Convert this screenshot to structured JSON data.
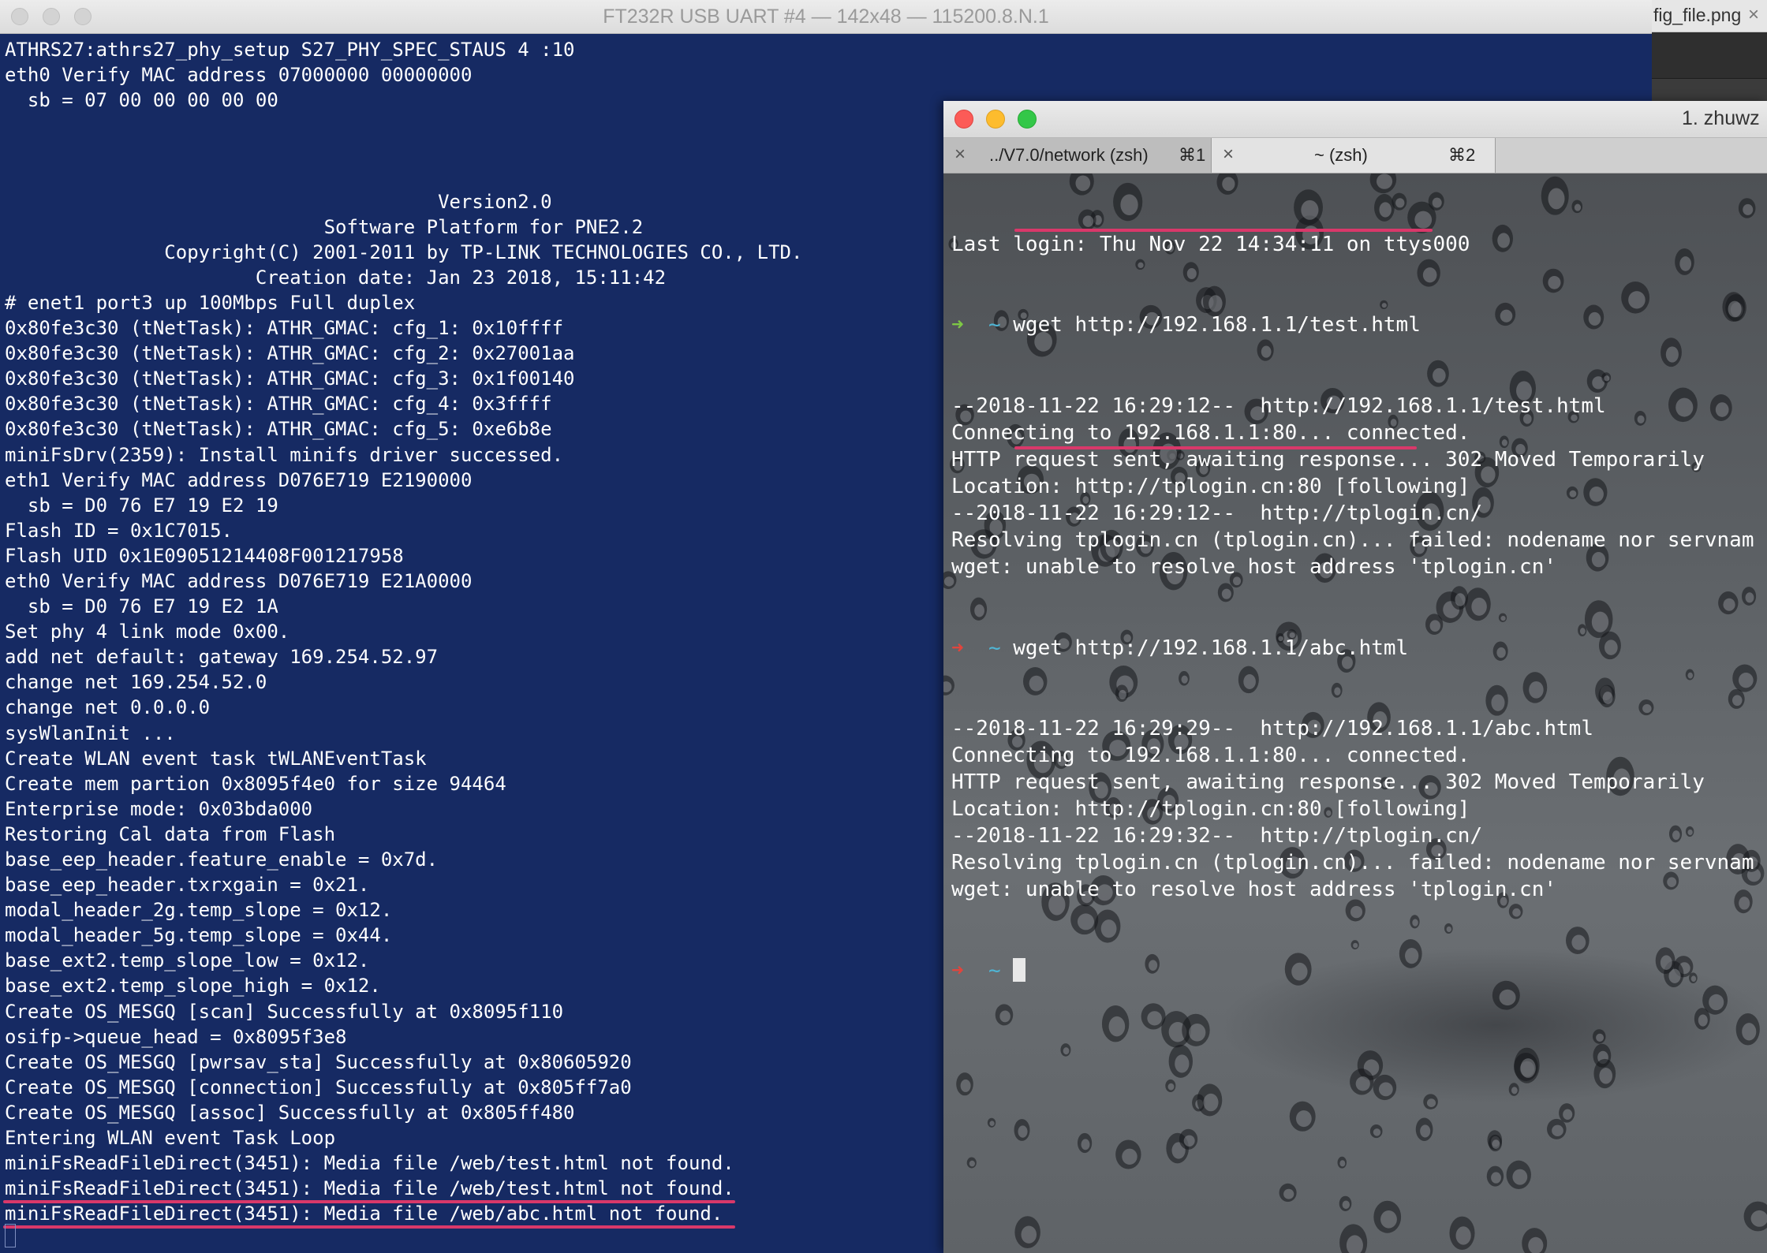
{
  "background_window": {
    "tab_name": "fig_file.png",
    "tab_close": "×"
  },
  "serial_window": {
    "title": "FT232R USB UART #4 — 142x48 — 115200.8.N.1",
    "lines": [
      "ATHRS27:athrs27_phy_setup S27_PHY_SPEC_STAUS 4 :10",
      "eth0 Verify MAC address 07000000 00000000",
      "  sb = 07 00 00 00 00 00",
      "",
      "",
      "",
      "                                      Version2.0",
      "                            Software Platform for PNE2.2",
      "              Copyright(C) 2001-2011 by TP-LINK TECHNOLOGIES CO., LTD.",
      "                      Creation date: Jan 23 2018, 15:11:42",
      "# enet1 port3 up 100Mbps Full duplex",
      "0x80fe3c30 (tNetTask): ATHR_GMAC: cfg_1: 0x10ffff",
      "0x80fe3c30 (tNetTask): ATHR_GMAC: cfg_2: 0x27001aa",
      "0x80fe3c30 (tNetTask): ATHR_GMAC: cfg_3: 0x1f00140",
      "0x80fe3c30 (tNetTask): ATHR_GMAC: cfg_4: 0x3ffff",
      "0x80fe3c30 (tNetTask): ATHR_GMAC: cfg_5: 0xe6b8e",
      "miniFsDrv(2359): Install minifs driver successed.",
      "eth1 Verify MAC address D076E719 E2190000",
      "  sb = D0 76 E7 19 E2 19",
      "Flash ID = 0x1C7015.",
      "Flash UID 0x1E09051214408F001217958",
      "eth0 Verify MAC address D076E719 E21A0000",
      "  sb = D0 76 E7 19 E2 1A",
      "Set phy 4 link mode 0x00.",
      "add net default: gateway 169.254.52.97",
      "change net 169.254.52.0",
      "change net 0.0.0.0",
      "sysWlanInit ...",
      "Create WLAN event task tWLANEventTask",
      "Create mem partion 0x8095f4e0 for size 94464",
      "Enterprise mode: 0x03bda000",
      "Restoring Cal data from Flash",
      "base_eep_header.feature_enable = 0x7d.",
      "base_eep_header.txrxgain = 0x21.",
      "modal_header_2g.temp_slope = 0x12.",
      "modal_header_5g.temp_slope = 0x44.",
      "base_ext2.temp_slope_low = 0x12.",
      "base_ext2.temp_slope_high = 0x12.",
      "Create OS_MESGQ [scan] Successfully at 0x8095f110",
      "osifp->queue_head = 0x8095f3e8",
      "Create OS_MESGQ [pwrsav_sta] Successfully at 0x80605920",
      "Create OS_MESGQ [connection] Successfully at 0x805ff7a0",
      "Create OS_MESGQ [assoc] Successfully at 0x805ff480",
      "Entering WLAN event Task Loop",
      "miniFsReadFileDirect(3451): Media file /web/test.html not found.",
      "miniFsReadFileDirect(3451): Media file /web/test.html not found.",
      "miniFsReadFileDirect(3451): Media file /web/abc.html not found."
    ]
  },
  "iterm_window": {
    "title": "1. zhuwz",
    "tabs": [
      {
        "close": "×",
        "label": "../V7.0/network (zsh)",
        "shortcut": "⌘1"
      },
      {
        "close": "×",
        "label": "~ (zsh)",
        "shortcut": "⌘2"
      }
    ],
    "prompt_arrow": "➜",
    "prompt_tilde": "~",
    "last_login": "Last login: Thu Nov 22 14:34:11 on ttys000",
    "cmd1": "wget http://192.168.1.1/test.html",
    "out1": [
      "--2018-11-22 16:29:12--  http://192.168.1.1/test.html",
      "Connecting to 192.168.1.1:80... connected.",
      "HTTP request sent, awaiting response... 302 Moved Temporarily",
      "Location: http://tplogin.cn:80 [following]",
      "--2018-11-22 16:29:12--  http://tplogin.cn/",
      "Resolving tplogin.cn (tplogin.cn)... failed: nodename nor servnam",
      "wget: unable to resolve host address 'tplogin.cn'"
    ],
    "cmd2": "wget http://192.168.1.1/abc.html",
    "out2": [
      "--2018-11-22 16:29:29--  http://192.168.1.1/abc.html",
      "Connecting to 192.168.1.1:80... connected.",
      "HTTP request sent, awaiting response... 302 Moved Temporarily",
      "Location: http://tplogin.cn:80 [following]",
      "--2018-11-22 16:29:32--  http://tplogin.cn/",
      "Resolving tplogin.cn (tplogin.cn)... failed: nodename nor servnam",
      "wget: unable to resolve host address 'tplogin.cn'"
    ]
  },
  "colors": {
    "serial_bg": "#162a63",
    "annotation_underline": "#d9386a",
    "prompt_ok": "#7ec845",
    "prompt_err": "#e0453d",
    "prompt_tilde": "#4fb6d6"
  }
}
